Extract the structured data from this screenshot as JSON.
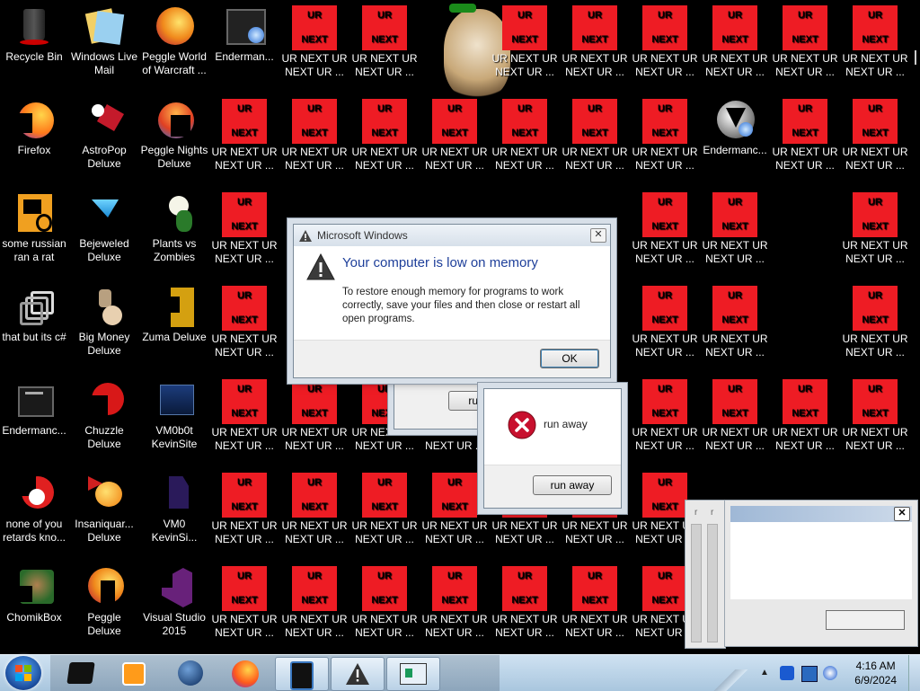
{
  "desktop_icons": [
    {
      "label": "Recycle Bin",
      "icon": "recycle-bin-icon"
    },
    {
      "label": "Windows Live Mail",
      "icon": "mail-icon"
    },
    {
      "label": "Peggle World of Warcraft ...",
      "icon": "peggle-icon"
    },
    {
      "label": "Enderman...",
      "icon": "enderman-icon"
    },
    {
      "label": "Firefox",
      "icon": "firefox-icon"
    },
    {
      "label": "AstroPop Deluxe",
      "icon": "astropop-icon"
    },
    {
      "label": "Peggle Nights Deluxe",
      "icon": "peggle-nights-icon"
    },
    {
      "label": "some russian ran a rat",
      "icon": "rat-icon"
    },
    {
      "label": "Bejeweled Deluxe",
      "icon": "bejeweled-icon"
    },
    {
      "label": "Plants vs Zombies",
      "icon": "plants-icon"
    },
    {
      "label": "that but its c#",
      "icon": "window-stack-icon"
    },
    {
      "label": "Big Money Deluxe",
      "icon": "money-icon"
    },
    {
      "label": "Zuma Deluxe",
      "icon": "zuma-icon"
    },
    {
      "label": "Endermanc...",
      "icon": "enderman-icon"
    },
    {
      "label": "Chuzzle Deluxe",
      "icon": "chuzzle-icon"
    },
    {
      "label": "VM0b0t KevinSite",
      "icon": "vm-icon"
    },
    {
      "label": "none of you retards kno...",
      "icon": "red-circle-icon"
    },
    {
      "label": "Insaniquar... Deluxe",
      "icon": "fish-icon"
    },
    {
      "label": "VM0 KevinSi...",
      "icon": "vm-icon"
    },
    {
      "label": "ChomikBox",
      "icon": "chomikbox-icon"
    },
    {
      "label": "Peggle Deluxe",
      "icon": "peggle-icon"
    },
    {
      "label": "Visual Studio 2015",
      "icon": "visual-studio-icon"
    },
    {
      "label": "Endermanc...",
      "icon": "enderman-icon"
    }
  ],
  "ur_icon": {
    "top": "UR",
    "bottom": "NEXT",
    "label": "UR NEXT UR NEXT UR ..."
  },
  "dialog_memory": {
    "title": "Microsoft Windows",
    "heading": "Your computer is low on memory",
    "message": "To restore enough memory for programs to work correctly, save your files and then close or restart all open programs.",
    "ok": "OK"
  },
  "dialog_back": {
    "button": "run"
  },
  "dialog_runaway": {
    "message": "run away",
    "button": "run away"
  },
  "small_window_labels": [
    "r",
    "r"
  ],
  "taskbar": {
    "items": [
      "windows-explorer-icon",
      "media-player-icon",
      "network-globe-icon",
      "firefox-icon",
      "phone-icon",
      "warning-icon",
      "program-window-icon"
    ],
    "time": "4:16 AM",
    "date": "6/9/2024"
  },
  "colors": {
    "ur_red": "#ee1c24",
    "taskbar": "#b7d0e6",
    "heading_blue": "#1e3f9a"
  }
}
